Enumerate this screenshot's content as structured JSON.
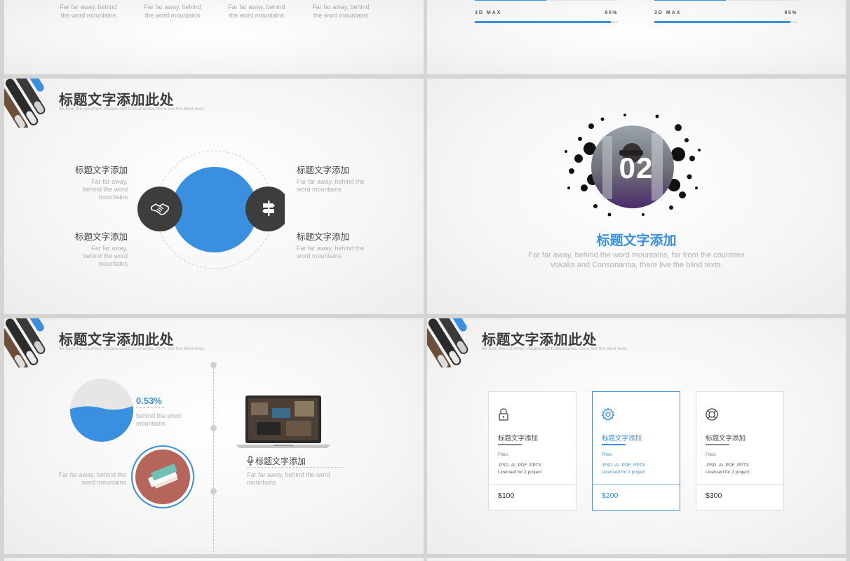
{
  "colors": {
    "accent": "#3a8fe0",
    "dark": "#3d3d3d",
    "light_text": "#aaaaaa"
  },
  "slide_top_left": {
    "items": [
      {
        "desc": "Far far away, behind the word mountains"
      },
      {
        "desc": "Far far away, behind the word mountains"
      },
      {
        "desc": "Far far away, behind the word mountains"
      },
      {
        "desc": "Far far away, behind the word mountains"
      }
    ]
  },
  "slide_top_right": {
    "skills": [
      {
        "name": "3D MAX",
        "percent_label": "95%",
        "level": 0.95
      },
      {
        "name": "3D MAX",
        "percent_label": "95%",
        "level": 0.95
      }
    ]
  },
  "slide_circles": {
    "title": "标题文字添加此处",
    "subtitle": "far from the countries Vokalia and Consonantia, there live the blind texts.",
    "left_icon": "handshake-icon",
    "right_icon": "signpost-icon",
    "items": [
      {
        "title": "标题文字添加",
        "desc": "Far far away, behind the word mountains"
      },
      {
        "title": "标题文字添加",
        "desc": "Far far away, behind the word mountains"
      },
      {
        "title": "标题文字添加",
        "desc": "Far far away, behind the word mountains"
      },
      {
        "title": "标题文字添加",
        "desc": "Far far away, behind the word mountains"
      }
    ]
  },
  "slide_section": {
    "number": "02",
    "title": "标题文字添加",
    "desc_line1": "Far far away, behind the word mountains, far from the countries",
    "desc_line2": "Vokalia and Consonantia, there live the blind texts."
  },
  "slide_timeline": {
    "title": "标题文字添加此处",
    "subtitle": "far from the countries Vokalia and Consonantia, there live the blind texts.",
    "percent": "0.53%",
    "percent_desc": "behind the word mountains",
    "left_desc": "Far far away, behind the word mountains",
    "right_title": "标题文字添加",
    "right_desc": "Far far away, behind the word mountains",
    "right_icon": "microphone-icon"
  },
  "slide_pricing": {
    "title": "标题文字添加此处",
    "subtitle": "far from the countries Vokalia and Consonantia, there live the blind texts.",
    "cards": [
      {
        "icon": "lock-icon",
        "title": "标题文字添加",
        "files_label": "Files:",
        "formats": ".PSD .AI .PDF .PPTX",
        "license": "Licensed for 2 project",
        "price": "$100"
      },
      {
        "icon": "gear-icon",
        "title": "标题文字添加",
        "files_label": "Files:",
        "formats": ".PSD .AI .PDF .PPTX",
        "license": "Licensed for 2 project",
        "price": "$200"
      },
      {
        "icon": "lifebuoy-icon",
        "title": "标题文字添加",
        "files_label": "Files:",
        "formats": ".PSD .AI .PDF .PPTX",
        "license": "Licensed for 2 project",
        "price": "$300"
      }
    ]
  }
}
